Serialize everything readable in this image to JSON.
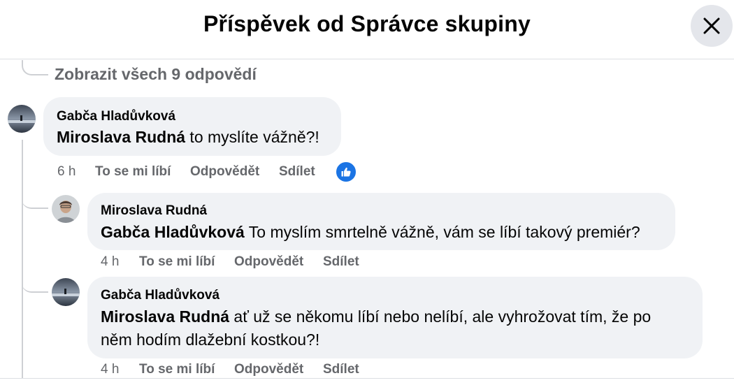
{
  "header": {
    "title": "Příspěvek od Správce skupiny"
  },
  "view_all": "Zobrazit všech 9 odpovědí",
  "comments": [
    {
      "author": "Gabča Hladůvková",
      "mention": "Miroslava Rudná",
      "text": " to myslíte vážně?!",
      "time": "6 h",
      "like": "To se mi líbí",
      "reply": "Odpovědět",
      "share": "Sdílet",
      "reaction": "like-reaction-icon"
    },
    {
      "author": "Miroslava Rudná",
      "mention": "Gabča Hladůvková",
      "text": " To myslím smrtelně vážně, vám se líbí takový premiér?",
      "time": "4 h",
      "like": "To se mi líbí",
      "reply": "Odpovědět",
      "share": "Sdílet"
    },
    {
      "author": "Gabča Hladůvková",
      "mention": "Miroslava Rudná",
      "text_line1": " ať už se někomu líbí nebo nelíbí, ale vyhrožovat tím, že po",
      "text_line2": "něm hodím dlažební kostkou?!",
      "time": "4 h",
      "like": "To se mi líbí",
      "reply": "Odpovědět",
      "share": "Sdílet"
    }
  ],
  "colors": {
    "accent": "#1b74e4",
    "bubble": "#f0f2f5",
    "muted": "#65676b"
  }
}
